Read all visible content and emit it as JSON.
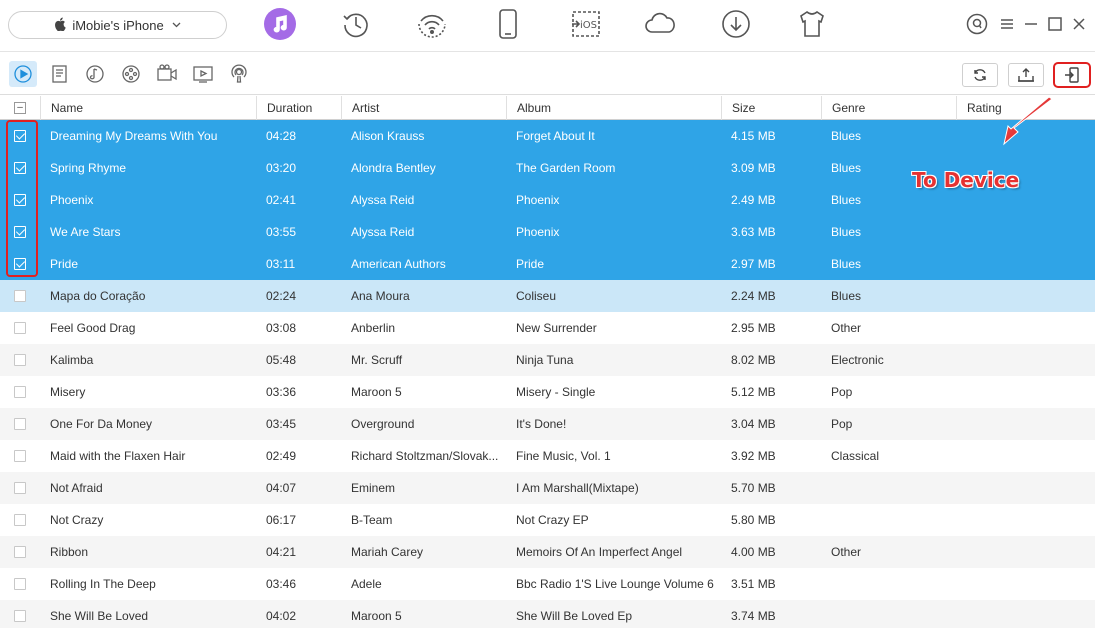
{
  "device": {
    "name": "iMobie's iPhone"
  },
  "colors": {
    "accent": "#a46be6",
    "selected_row": "#2fa4e7",
    "hover_row": "#cbe7f8",
    "annotation": "#e63232"
  },
  "top_nav": [
    {
      "icon": "music-icon",
      "active": true
    },
    {
      "icon": "clock-icon"
    },
    {
      "icon": "wifi-icon"
    },
    {
      "icon": "phone-icon"
    },
    {
      "icon": "to-ios-icon",
      "label": "iOS"
    },
    {
      "icon": "cloud-icon"
    },
    {
      "icon": "download-icon"
    },
    {
      "icon": "tshirt-icon"
    }
  ],
  "window_controls": [
    "account-icon",
    "menu-icon",
    "minimize-icon",
    "maximize-icon",
    "close-icon"
  ],
  "categories": [
    "music-category-icon",
    "playlist-icon",
    "ringtone-icon",
    "audiobook-icon",
    "video-icon",
    "tv-icon",
    "podcast-icon"
  ],
  "toolbar_buttons": [
    "refresh-icon",
    "to-computer-icon",
    "to-device-icon"
  ],
  "table": {
    "columns": [
      "Name",
      "Duration",
      "Artist",
      "Album",
      "Size",
      "Genre",
      "Rating"
    ],
    "rows": [
      {
        "name": "Dreaming My Dreams With You",
        "duration": "04:28",
        "artist": "Alison Krauss",
        "album": "Forget About It",
        "size": "4.15 MB",
        "genre": "Blues",
        "state": "sel"
      },
      {
        "name": "Spring Rhyme",
        "duration": "03:20",
        "artist": "Alondra Bentley",
        "album": "The Garden Room",
        "size": "3.09 MB",
        "genre": "Blues",
        "state": "sel"
      },
      {
        "name": "Phoenix",
        "duration": "02:41",
        "artist": "Alyssa Reid",
        "album": "Phoenix",
        "size": "2.49 MB",
        "genre": "Blues",
        "state": "sel"
      },
      {
        "name": "We Are Stars",
        "duration": "03:55",
        "artist": "Alyssa Reid",
        "album": "Phoenix",
        "size": "3.63 MB",
        "genre": "Blues",
        "state": "sel"
      },
      {
        "name": "Pride",
        "duration": "03:11",
        "artist": "American Authors",
        "album": "Pride",
        "size": "2.97 MB",
        "genre": "Blues",
        "state": "sel"
      },
      {
        "name": "Mapa do Coração",
        "duration": "02:24",
        "artist": "Ana Moura",
        "album": "Coliseu",
        "size": "2.24 MB",
        "genre": "Blues",
        "state": "hover"
      },
      {
        "name": "Feel Good Drag",
        "duration": "03:08",
        "artist": "Anberlin",
        "album": "New Surrender",
        "size": "2.95 MB",
        "genre": "Other",
        "state": "normal"
      },
      {
        "name": "Kalimba",
        "duration": "05:48",
        "artist": "Mr. Scruff",
        "album": "Ninja Tuna",
        "size": "8.02 MB",
        "genre": "Electronic",
        "state": "alt"
      },
      {
        "name": "Misery",
        "duration": "03:36",
        "artist": "Maroon 5",
        "album": "Misery - Single",
        "size": "5.12 MB",
        "genre": "Pop",
        "state": "normal"
      },
      {
        "name": "One For Da Money",
        "duration": "03:45",
        "artist": "Overground",
        "album": "It's Done!",
        "size": "3.04 MB",
        "genre": "Pop",
        "state": "alt"
      },
      {
        "name": "Maid with the Flaxen Hair",
        "duration": "02:49",
        "artist": "Richard Stoltzman/Slovak...",
        "album": "Fine Music, Vol. 1",
        "size": "3.92 MB",
        "genre": "Classical",
        "state": "normal"
      },
      {
        "name": "Not Afraid",
        "duration": "04:07",
        "artist": "Eminem",
        "album": "I Am Marshall(Mixtape)",
        "size": "5.70 MB",
        "genre": "",
        "state": "alt"
      },
      {
        "name": "Not Crazy",
        "duration": "06:17",
        "artist": "B-Team",
        "album": "Not Crazy EP",
        "size": "5.80 MB",
        "genre": "",
        "state": "normal"
      },
      {
        "name": "Ribbon",
        "duration": "04:21",
        "artist": "Mariah Carey",
        "album": "Memoirs Of An Imperfect Angel",
        "size": "4.00 MB",
        "genre": "Other",
        "state": "alt"
      },
      {
        "name": "Rolling In The Deep",
        "duration": "03:46",
        "artist": "Adele",
        "album": "Bbc Radio 1'S Live Lounge Volume 6",
        "size": "3.51 MB",
        "genre": "",
        "state": "normal"
      },
      {
        "name": "She Will Be Loved",
        "duration": "04:02",
        "artist": "Maroon 5",
        "album": "She Will Be Loved Ep",
        "size": "3.74 MB",
        "genre": "",
        "state": "alt"
      }
    ]
  },
  "annotation": {
    "text": "To Device"
  }
}
